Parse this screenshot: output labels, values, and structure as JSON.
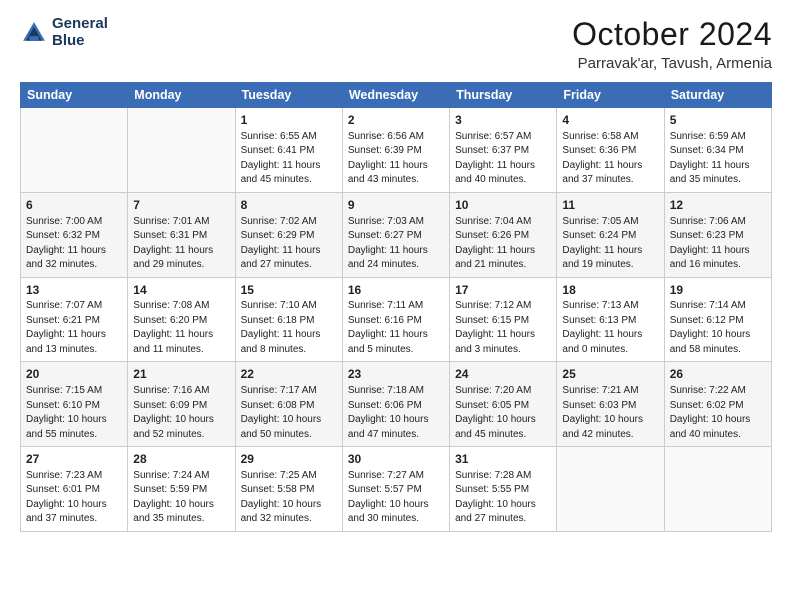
{
  "logo": {
    "line1": "General",
    "line2": "Blue"
  },
  "header": {
    "month": "October 2024",
    "location": "Parravak'ar, Tavush, Armenia"
  },
  "days_of_week": [
    "Sunday",
    "Monday",
    "Tuesday",
    "Wednesday",
    "Thursday",
    "Friday",
    "Saturday"
  ],
  "weeks": [
    [
      {
        "day": "",
        "info": ""
      },
      {
        "day": "",
        "info": ""
      },
      {
        "day": "1",
        "info": "Sunrise: 6:55 AM\nSunset: 6:41 PM\nDaylight: 11 hours\nand 45 minutes."
      },
      {
        "day": "2",
        "info": "Sunrise: 6:56 AM\nSunset: 6:39 PM\nDaylight: 11 hours\nand 43 minutes."
      },
      {
        "day": "3",
        "info": "Sunrise: 6:57 AM\nSunset: 6:37 PM\nDaylight: 11 hours\nand 40 minutes."
      },
      {
        "day": "4",
        "info": "Sunrise: 6:58 AM\nSunset: 6:36 PM\nDaylight: 11 hours\nand 37 minutes."
      },
      {
        "day": "5",
        "info": "Sunrise: 6:59 AM\nSunset: 6:34 PM\nDaylight: 11 hours\nand 35 minutes."
      }
    ],
    [
      {
        "day": "6",
        "info": "Sunrise: 7:00 AM\nSunset: 6:32 PM\nDaylight: 11 hours\nand 32 minutes."
      },
      {
        "day": "7",
        "info": "Sunrise: 7:01 AM\nSunset: 6:31 PM\nDaylight: 11 hours\nand 29 minutes."
      },
      {
        "day": "8",
        "info": "Sunrise: 7:02 AM\nSunset: 6:29 PM\nDaylight: 11 hours\nand 27 minutes."
      },
      {
        "day": "9",
        "info": "Sunrise: 7:03 AM\nSunset: 6:27 PM\nDaylight: 11 hours\nand 24 minutes."
      },
      {
        "day": "10",
        "info": "Sunrise: 7:04 AM\nSunset: 6:26 PM\nDaylight: 11 hours\nand 21 minutes."
      },
      {
        "day": "11",
        "info": "Sunrise: 7:05 AM\nSunset: 6:24 PM\nDaylight: 11 hours\nand 19 minutes."
      },
      {
        "day": "12",
        "info": "Sunrise: 7:06 AM\nSunset: 6:23 PM\nDaylight: 11 hours\nand 16 minutes."
      }
    ],
    [
      {
        "day": "13",
        "info": "Sunrise: 7:07 AM\nSunset: 6:21 PM\nDaylight: 11 hours\nand 13 minutes."
      },
      {
        "day": "14",
        "info": "Sunrise: 7:08 AM\nSunset: 6:20 PM\nDaylight: 11 hours\nand 11 minutes."
      },
      {
        "day": "15",
        "info": "Sunrise: 7:10 AM\nSunset: 6:18 PM\nDaylight: 11 hours\nand 8 minutes."
      },
      {
        "day": "16",
        "info": "Sunrise: 7:11 AM\nSunset: 6:16 PM\nDaylight: 11 hours\nand 5 minutes."
      },
      {
        "day": "17",
        "info": "Sunrise: 7:12 AM\nSunset: 6:15 PM\nDaylight: 11 hours\nand 3 minutes."
      },
      {
        "day": "18",
        "info": "Sunrise: 7:13 AM\nSunset: 6:13 PM\nDaylight: 11 hours\nand 0 minutes."
      },
      {
        "day": "19",
        "info": "Sunrise: 7:14 AM\nSunset: 6:12 PM\nDaylight: 10 hours\nand 58 minutes."
      }
    ],
    [
      {
        "day": "20",
        "info": "Sunrise: 7:15 AM\nSunset: 6:10 PM\nDaylight: 10 hours\nand 55 minutes."
      },
      {
        "day": "21",
        "info": "Sunrise: 7:16 AM\nSunset: 6:09 PM\nDaylight: 10 hours\nand 52 minutes."
      },
      {
        "day": "22",
        "info": "Sunrise: 7:17 AM\nSunset: 6:08 PM\nDaylight: 10 hours\nand 50 minutes."
      },
      {
        "day": "23",
        "info": "Sunrise: 7:18 AM\nSunset: 6:06 PM\nDaylight: 10 hours\nand 47 minutes."
      },
      {
        "day": "24",
        "info": "Sunrise: 7:20 AM\nSunset: 6:05 PM\nDaylight: 10 hours\nand 45 minutes."
      },
      {
        "day": "25",
        "info": "Sunrise: 7:21 AM\nSunset: 6:03 PM\nDaylight: 10 hours\nand 42 minutes."
      },
      {
        "day": "26",
        "info": "Sunrise: 7:22 AM\nSunset: 6:02 PM\nDaylight: 10 hours\nand 40 minutes."
      }
    ],
    [
      {
        "day": "27",
        "info": "Sunrise: 7:23 AM\nSunset: 6:01 PM\nDaylight: 10 hours\nand 37 minutes."
      },
      {
        "day": "28",
        "info": "Sunrise: 7:24 AM\nSunset: 5:59 PM\nDaylight: 10 hours\nand 35 minutes."
      },
      {
        "day": "29",
        "info": "Sunrise: 7:25 AM\nSunset: 5:58 PM\nDaylight: 10 hours\nand 32 minutes."
      },
      {
        "day": "30",
        "info": "Sunrise: 7:27 AM\nSunset: 5:57 PM\nDaylight: 10 hours\nand 30 minutes."
      },
      {
        "day": "31",
        "info": "Sunrise: 7:28 AM\nSunset: 5:55 PM\nDaylight: 10 hours\nand 27 minutes."
      },
      {
        "day": "",
        "info": ""
      },
      {
        "day": "",
        "info": ""
      }
    ]
  ]
}
